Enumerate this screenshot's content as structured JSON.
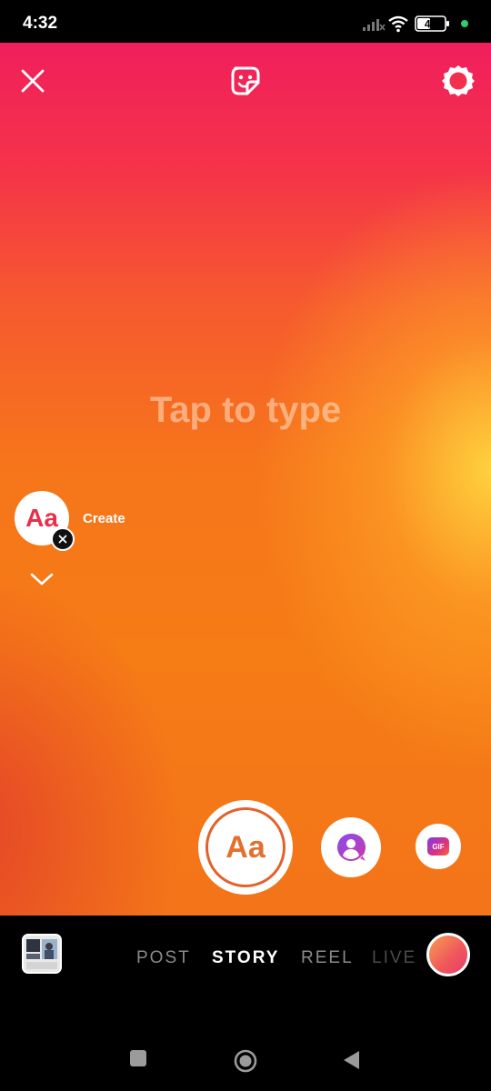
{
  "status_bar": {
    "time": "4:32",
    "battery_level": "46",
    "icons": [
      "signal-icon",
      "wifi-icon",
      "battery-icon",
      "dot-indicator"
    ],
    "dot_color": "#2ecc71"
  },
  "top_bar": {
    "icons": [
      "close-icon",
      "sticker-icon",
      "settings-icon"
    ]
  },
  "canvas": {
    "prompt": "Tap to type",
    "gradient_colors": [
      "#f01f5c",
      "#f65a2e",
      "#f67c16",
      "#ffd640"
    ]
  },
  "create_effect": {
    "thumbnail_text": "Aa",
    "label": "Create"
  },
  "modes": {
    "text_label": "Aa",
    "mention_icon": "mention-icon",
    "gif_label": "GIF"
  },
  "bottom_tabs": {
    "items": [
      "POST",
      "STORY",
      "REEL",
      "LIVE"
    ],
    "selected": "STORY"
  },
  "nav": {
    "icons": [
      "recents-icon",
      "home-icon",
      "back-icon"
    ]
  }
}
